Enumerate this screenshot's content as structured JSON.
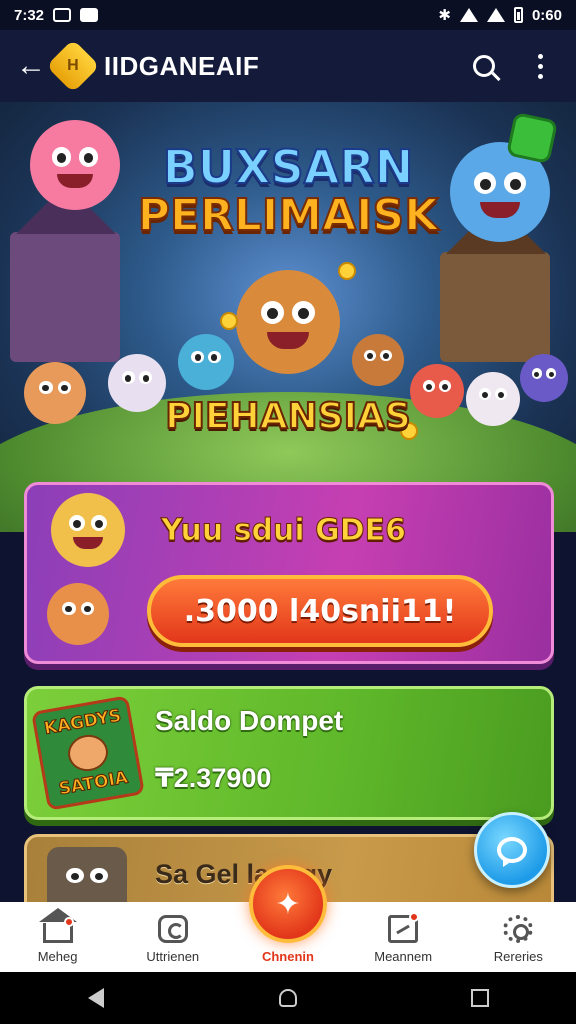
{
  "status_bar": {
    "time_left": "7:32",
    "time_right": "0:60"
  },
  "app_bar": {
    "logo_glyph": "H",
    "title": "IIDGANEAIF"
  },
  "hero": {
    "title_1": "BUXSARN",
    "title_2": "PERLIMAISK",
    "subtitle": "PIEHANSIAS"
  },
  "cards": {
    "promo": {
      "title": "Yuu sdui GDE6",
      "button_label": ".3000 l40snii11!"
    },
    "wallet": {
      "badge_top": "KAGDYS",
      "badge_bottom": "SATOIA",
      "title": "Saldo Dompet",
      "amount": "₸2.37900"
    },
    "third": {
      "title": "Sa Gel lagagy"
    }
  },
  "bottom_nav": {
    "items": [
      {
        "label": "Meheg",
        "icon": "home-icon"
      },
      {
        "label": "Uttrienen",
        "icon": "game-icon"
      },
      {
        "label": "Chnenin",
        "icon": "center-play-icon"
      },
      {
        "label": "Meannem",
        "icon": "task-icon"
      },
      {
        "label": "Rereries",
        "icon": "gear-icon"
      }
    ]
  },
  "colors": {
    "accent": "#e2361a",
    "promo": "#c63fb2",
    "wallet": "#5fb82a",
    "fab": "#1e9be8"
  }
}
